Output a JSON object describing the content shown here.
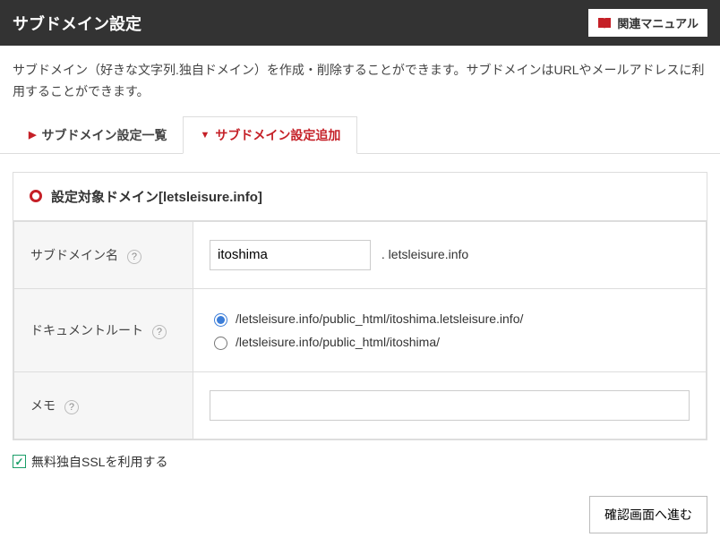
{
  "header": {
    "title": "サブドメイン設定",
    "manual_button": "関連マニュアル"
  },
  "description": "サブドメイン（好きな文字列.独自ドメイン）を作成・削除することができます。サブドメインはURLやメールアドレスに利用することができます。",
  "tabs": {
    "list": "サブドメイン設定一覧",
    "add": "サブドメイン設定追加"
  },
  "panel": {
    "heading_prefix": "設定対象ドメイン",
    "domain": "letsleisure.info"
  },
  "form": {
    "subdomain_label": "サブドメイン名",
    "subdomain_value": "itoshima",
    "subdomain_suffix": ". letsleisure.info",
    "docroot_label": "ドキュメントルート",
    "docroot_options": [
      "/letsleisure.info/public_html/itoshima.letsleisure.info/",
      "/letsleisure.info/public_html/itoshima/"
    ],
    "memo_label": "メモ",
    "memo_value": ""
  },
  "ssl": {
    "label": "無料独自SSLを利用する",
    "checked": true
  },
  "submit": {
    "label": "確認画面へ進む"
  }
}
